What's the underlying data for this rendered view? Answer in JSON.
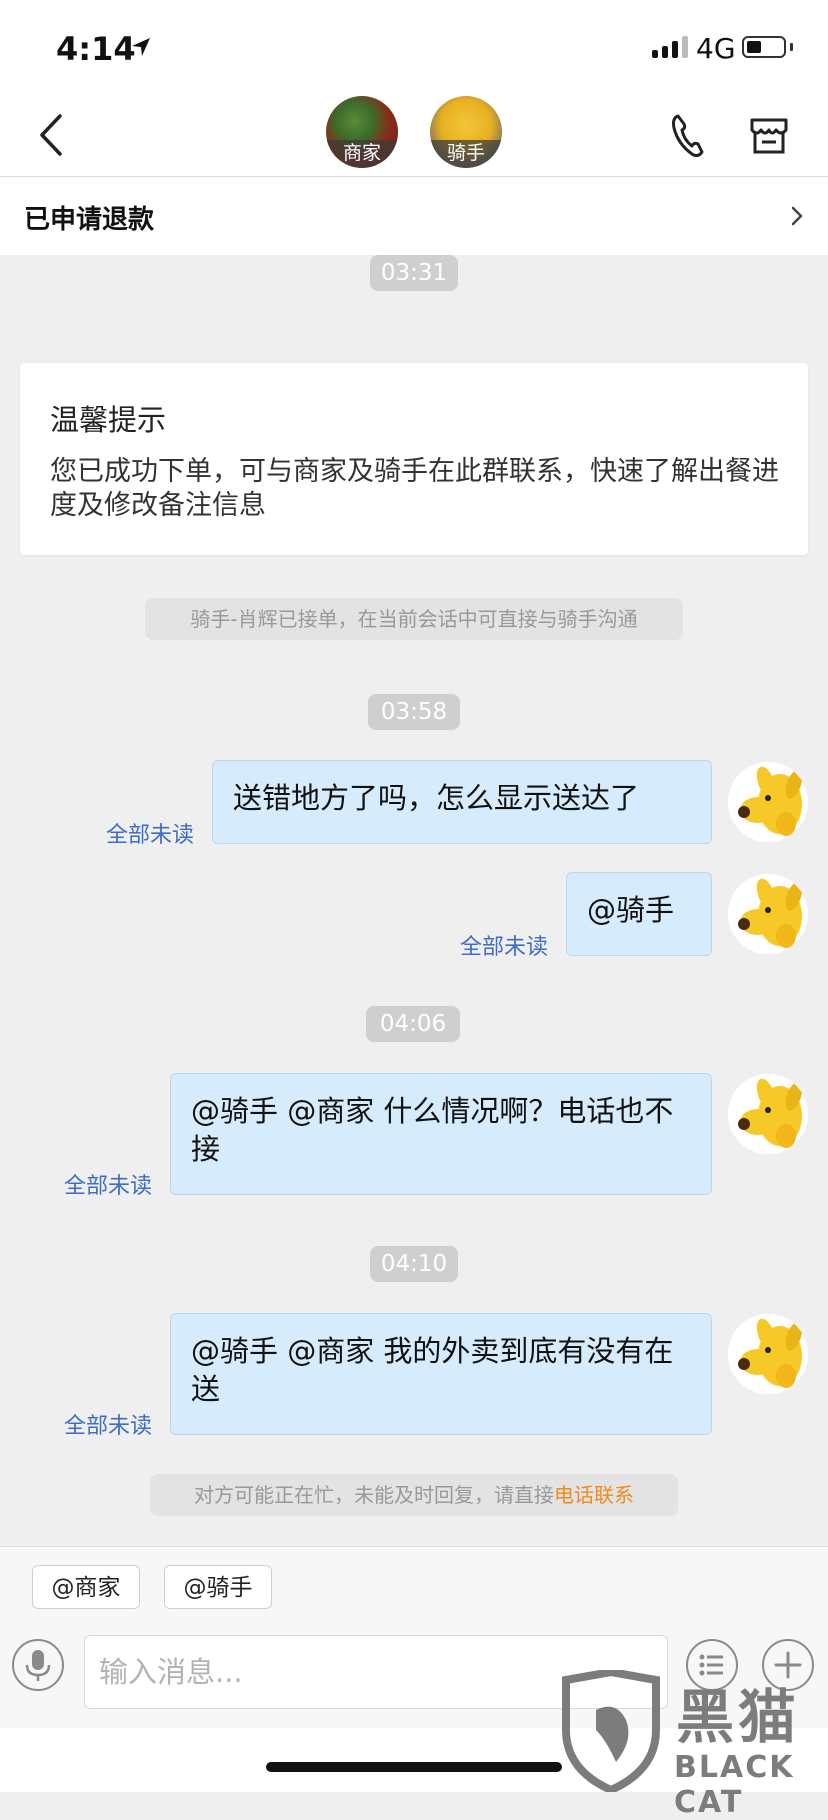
{
  "status_bar": {
    "time": "4:14",
    "network": "4G"
  },
  "header": {
    "participants": [
      {
        "label": "商家"
      },
      {
        "label": "骑手"
      }
    ]
  },
  "order_status": {
    "label": "已申请退款"
  },
  "chat": {
    "timestamps": [
      "03:31",
      "03:58",
      "04:06",
      "04:10"
    ],
    "notice": {
      "title": "温馨提示",
      "body": "您已成功下单，可与商家及骑手在此群联系，快速了解出餐进度及修改备注信息"
    },
    "system_rider": "骑手-肖辉已接单，在当前会话中可直接与骑手沟通",
    "messages": [
      {
        "text": "送错地方了吗，怎么显示送达了",
        "status": "全部未读"
      },
      {
        "text": "@骑手",
        "status": "全部未读"
      },
      {
        "text": "@骑手 @商家 什么情况啊？电话也不接",
        "status": "全部未读"
      },
      {
        "text": "@骑手 @商家 我的外卖到底有没有在送",
        "status": "全部未读"
      }
    ],
    "busy_notice": {
      "text": "对方可能正在忙，未能及时回复，请直接",
      "link": "电话联系"
    }
  },
  "composer": {
    "mentions": [
      "@商家",
      "@骑手"
    ],
    "placeholder": "输入消息..."
  },
  "watermark": {
    "text": "黑猫",
    "sub": "BLACK CAT"
  },
  "colors": {
    "bubble": "#d6ebfb",
    "unread": "#3f6cc7",
    "link": "#f08a1a"
  }
}
